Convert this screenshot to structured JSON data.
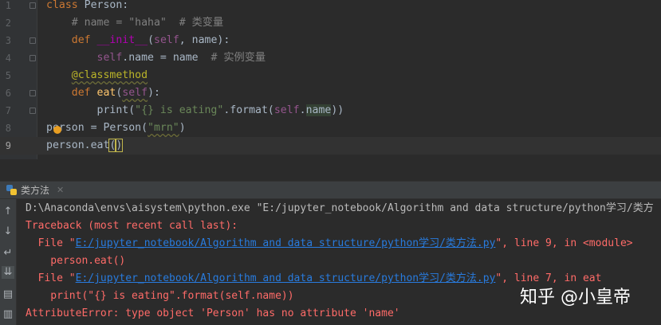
{
  "editor": {
    "lines": [
      {
        "num": "1",
        "text": "class Person:"
      },
      {
        "num": "2",
        "text": "    # name = \"haha\"  # 类变量"
      },
      {
        "num": "3",
        "text": "    def __init__(self, name):"
      },
      {
        "num": "4",
        "text": "        self.name = name  # 实例变量"
      },
      {
        "num": "5",
        "text": "    @classmethod"
      },
      {
        "num": "6",
        "text": "    def eat(self):"
      },
      {
        "num": "7",
        "text": "        print(\"{} is eating\".format(self.name))"
      },
      {
        "num": "8",
        "text": "person = Person(\"mrn\")"
      },
      {
        "num": "9",
        "text": "person.eat()"
      }
    ]
  },
  "run": {
    "tab_label": "类方法",
    "tab_icon": "python-file-icon",
    "toolbar": [
      "up-arrow-icon",
      "down-arrow-icon",
      "soft-wrap-icon",
      "scroll-to-end-icon",
      "print-icon",
      "trash-icon"
    ],
    "output": {
      "command": "D:\\Anaconda\\envs\\aisystem\\python.exe \"E:/jupyter_notebook/Algorithm and data structure/python学习/类方",
      "traceback": "Traceback (most recent call last):",
      "frame1": {
        "prefix": "  File \"",
        "path": "E:/jupyter_notebook/Algorithm and data structure/python学习/类方法.py",
        "suffix": "\", line 9, in <module>",
        "code": "    person.eat()"
      },
      "frame2": {
        "prefix": "  File \"",
        "path": "E:/jupyter_notebook/Algorithm and data structure/python学习/类方法.py",
        "suffix": "\", line 7, in eat",
        "code": "    print(\"{} is eating\".format(self.name))"
      },
      "error": "AttributeError: type object 'Person' has no attribute 'name'"
    }
  },
  "watermark": "知乎 @小皇帝",
  "colors": {
    "background": "#2b2b2b",
    "keyword": "#cc7832",
    "string": "#6a8759",
    "comment": "#808080",
    "function": "#ffc66d",
    "error": "#ff6b68",
    "link": "#287bde"
  }
}
